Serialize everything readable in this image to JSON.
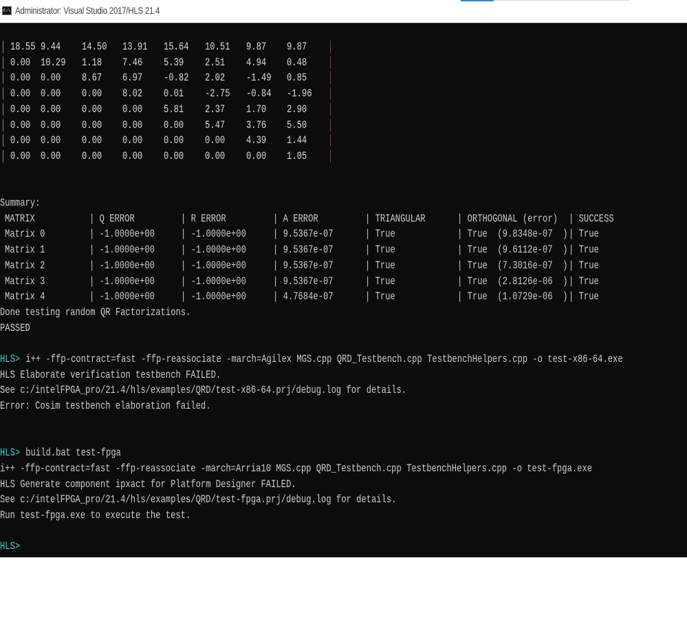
{
  "window": {
    "title": "Administrator: Visual Studio 2017/HLS 21.4",
    "icon": "cmd-icon"
  },
  "colors": {
    "background": "#0c0c0c",
    "text": "#cccccc",
    "prompt": "#3acfd0"
  },
  "matrix": [
    [
      "18.55",
      "9.44",
      "14.50",
      "13.91",
      "15.64",
      "10.51",
      "9.87",
      "9.87"
    ],
    [
      "0.00",
      "10.29",
      "1.18",
      "7.46",
      "5.39",
      "2.51",
      "4.94",
      "0.48"
    ],
    [
      "0.00",
      "0.00",
      "8.67",
      "6.97",
      "-0.82",
      "2.02",
      "-1.49",
      "0.85"
    ],
    [
      "0.00",
      "0.00",
      "0.00",
      "8.02",
      "0.01",
      "-2.75",
      "-0.84",
      "-1.96"
    ],
    [
      "0.00",
      "0.00",
      "0.00",
      "0.00",
      "5.81",
      "2.37",
      "1.70",
      "2.90"
    ],
    [
      "0.00",
      "0.00",
      "0.00",
      "0.00",
      "0.00",
      "5.47",
      "3.76",
      "5.50"
    ],
    [
      "0.00",
      "0.00",
      "0.00",
      "0.00",
      "0.00",
      "0.00",
      "4.39",
      "1.44"
    ],
    [
      "0.00",
      "0.00",
      "0.00",
      "0.00",
      "0.00",
      "0.00",
      "0.00",
      "1.05"
    ]
  ],
  "summary": {
    "label": "Summary:",
    "headers": [
      "MATRIX",
      "| Q ERROR",
      "| R ERROR",
      "| A ERROR",
      "| TRIANGULAR",
      "| ORTHOGONAL (error)",
      "| SUCCESS"
    ],
    "rows": [
      [
        "Matrix 0",
        "| -1.0000e+00",
        "| -1.0000e+00",
        "| 9.5367e-07",
        "| True",
        "| True  (9.8348e-07  )",
        "| True"
      ],
      [
        "Matrix 1",
        "| -1.0000e+00",
        "| -1.0000e+00",
        "| 9.5367e-07",
        "| True",
        "| True  (9.6112e-07  )",
        "| True"
      ],
      [
        "Matrix 2",
        "| -1.0000e+00",
        "| -1.0000e+00",
        "| 9.5367e-07",
        "| True",
        "| True  (7.3016e-07  )",
        "| True"
      ],
      [
        "Matrix 3",
        "| -1.0000e+00",
        "| -1.0000e+00",
        "| 9.5367e-07",
        "| True",
        "| True  (2.8126e-06  )",
        "| True"
      ],
      [
        "Matrix 4",
        "| -1.0000e+00",
        "| -1.0000e+00",
        "| 4.7684e-07",
        "| True",
        "| True  (1.0729e-06  )",
        "| True"
      ]
    ],
    "done": "Done testing random QR Factorizations.",
    "result": "PASSED"
  },
  "log": [
    {
      "prompt": "HLS>",
      "text": " i++ -ffp-contract=fast -ffp-reassociate -march=Agilex MGS.cpp QRD_Testbench.cpp TestbenchHelpers.cpp -o test-x86-64.exe"
    },
    {
      "text": "HLS Elaborate verification testbench FAILED."
    },
    {
      "text": "See c:/intelFPGA_pro/21.4/hls/examples/QRD/test-x86-64.prj/debug.log for details."
    },
    {
      "text": "Error: Cosim testbench elaboration failed."
    },
    {
      "text": ""
    },
    {
      "text": ""
    },
    {
      "prompt": "HLS>",
      "text": " build.bat test-fpga"
    },
    {
      "text": "i++ -ffp-contract=fast -ffp-reassociate -march=Arria10 MGS.cpp QRD_Testbench.cpp TestbenchHelpers.cpp -o test-fpga.exe"
    },
    {
      "text": "HLS Generate component ipxact for Platform Designer FAILED."
    },
    {
      "text": "See c:/intelFPGA_pro/21.4/hls/examples/QRD/test-fpga.prj/debug.log for details."
    },
    {
      "text": "Run test-fpga.exe to execute the test."
    },
    {
      "text": ""
    },
    {
      "prompt": "HLS>",
      "text": ""
    }
  ]
}
